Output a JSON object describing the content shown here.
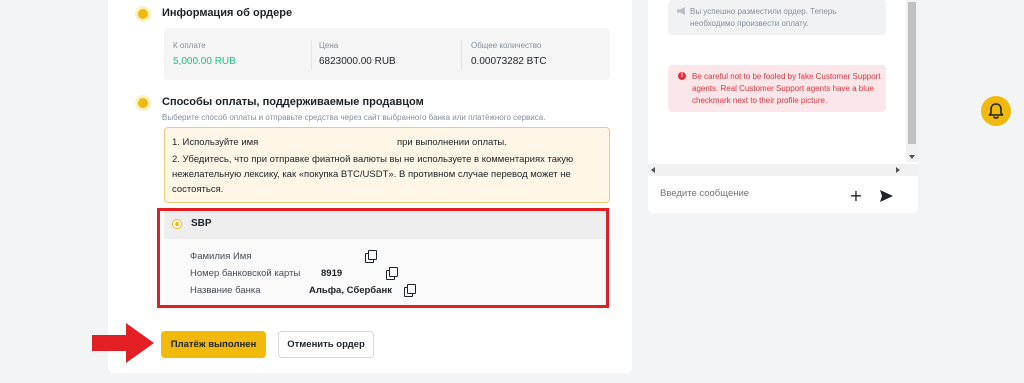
{
  "order_info": {
    "title": "Информация об ордере",
    "amount_label": "К оплате",
    "amount_value": "5,000.00 RUB",
    "price_label": "Цена",
    "price_value": "6823000.00 RUB",
    "quantity_label": "Общее количество",
    "quantity_value": "0.00073282 BTC"
  },
  "payment": {
    "title": "Способы оплаты, поддерживаемые продавцом",
    "hint": "Выберите способ оплаты и отправьте средства через сайт выбранного банка или платёжного сервиса.",
    "warning_1a": "1. Используйте имя",
    "warning_1b": "при выполнении оплаты.",
    "warning_2_line1": "2. Убедитесь, что при отправке фиатной валюты вы не используете в комментариях такую",
    "warning_2_line2": "нежелательную лексику, как «покупка BTC/USDT». В противном случае перевод может не",
    "warning_2_line3": "состояться.",
    "method_name": "SBP",
    "name_label": "Фамилия Имя",
    "name_value": "",
    "card_label": "Номер банковской карты",
    "card_value": "8919",
    "bank_label": "Название банка",
    "bank_value": "Альфа, Сбербанк"
  },
  "actions": {
    "confirm_label": "Платёж выполнен",
    "cancel_label": "Отменить ордер"
  },
  "chat": {
    "system_message": "Вы успешно разместили ордер. Теперь необходимо произвести оплату.",
    "warning_message": "Be careful not to be fooled by fake Customer Support agents. Real Customer Support agents have a blue checkmark next to their profile picture.",
    "input_placeholder": "Введите сообщение",
    "add_label": "+"
  },
  "colors": {
    "accent": "#f0b90b",
    "amount_green": "#0ecb81",
    "annotation_red": "#e31e24",
    "warning_red": "#e0323f"
  },
  "icons": [
    "copy-icon",
    "megaphone-icon",
    "alert-icon",
    "send-icon",
    "bell-icon",
    "arrow-annotation"
  ]
}
